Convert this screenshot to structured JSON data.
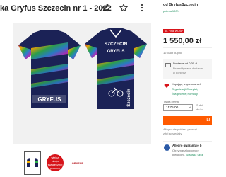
{
  "product": {
    "title": "ka Gryfus Szczecin nr 1 - 2022",
    "jersey_brand": "SZCZECIN",
    "jersey_brand_front": "SZCZECIN",
    "jersey_team": "GRYFUS",
    "jersey_side_text": "Szczecin",
    "thumb_badge_text": "wielka akcja świątecznej pomocy",
    "thumb_logo_text": "GRYFUS"
  },
  "icons": {
    "share": "share-icon",
    "favorite": "star-icon",
    "more": "more-icon"
  },
  "seller": {
    "name": "od GryfusSzczecin",
    "rating": "poleca 100%"
  },
  "offer": {
    "badge": "30. Finał WOŚP",
    "price": "1 550,00 zł",
    "sold": "12 osób kupiło"
  },
  "shipping": {
    "line1": "Dostawa od 0,00 zł",
    "line2": "Przewidywana dostawa:",
    "line3": "w poniedz"
  },
  "charity": {
    "line1": "Kupując, wspierasz cel",
    "line2": "Organizacji Charytaty",
    "line3": "Świątecznej Pomocy"
  },
  "bid": {
    "label": "Twoja oferta",
    "value": "1575,00",
    "unit": "zł",
    "side1": "S dni",
    "side2": "do ko"
  },
  "cta": {
    "label": "LI"
  },
  "info": {
    "line1": "Allegro nie pobiera prowizji",
    "line2": "z tej sprzedaży"
  },
  "protection": {
    "title": "Allegro gwarantuje b",
    "line1": "Otrzymasz kupony pr",
    "line2": "pieniędzy.",
    "link": "Sprawdź szcz"
  },
  "colors": {
    "accent": "#ff5a00",
    "brand_green": "#1a8c5b",
    "badge_red": "#d7141a",
    "jersey_navy": "#1b2256"
  }
}
